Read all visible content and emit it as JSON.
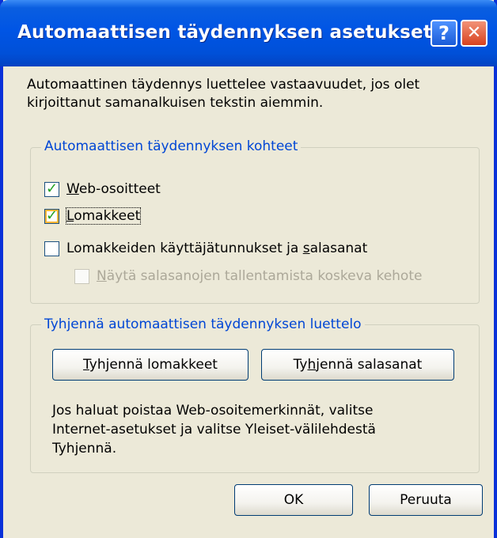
{
  "window": {
    "title": "Automaattisen täydennyksen asetukset",
    "help_glyph": "?",
    "close_glyph": "✕"
  },
  "intro": {
    "line1": "Automaattinen täydennys luettelee vastaavuudet, jos olet",
    "line2": "kirjoittanut samanalkuisen tekstin aiemmin."
  },
  "targets_group": {
    "legend": "Automaattisen täydennyksen kohteet",
    "web_addresses": {
      "label_first": "W",
      "label_rest": "eb-osoitteet",
      "checked": true
    },
    "forms": {
      "label_first": "L",
      "label_rest": "omakkeet",
      "checked": true
    },
    "credentials": {
      "label_before": "Lomakkeiden käyttäjätunnukset ja ",
      "label_access": "s",
      "label_after": "alasanat",
      "checked": false
    },
    "prompt_save": {
      "label_first": "N",
      "label_rest": "äytä salasanojen tallentamista koskeva kehote",
      "checked": false,
      "enabled": false
    }
  },
  "clear_group": {
    "legend": "Tyhjennä automaattisen täydennyksen luettelo",
    "clear_forms": {
      "first": "T",
      "rest": "yhjennä lomakkeet"
    },
    "clear_passwords": {
      "before": "Ty",
      "access": "h",
      "after": "jennä salasanat"
    },
    "info_line1": "Jos haluat poistaa Web-osoitemerkinnät, valitse",
    "info_line2": "Internet-asetukset ja valitse Yleiset-välilehdestä",
    "info_line3": "Tyhjennä."
  },
  "buttons": {
    "ok": "OK",
    "cancel": "Peruuta"
  },
  "colors": {
    "title_bar": "#0055e5",
    "face": "#ece9d8",
    "legend_text": "#0046d5",
    "check": "#21a121"
  }
}
